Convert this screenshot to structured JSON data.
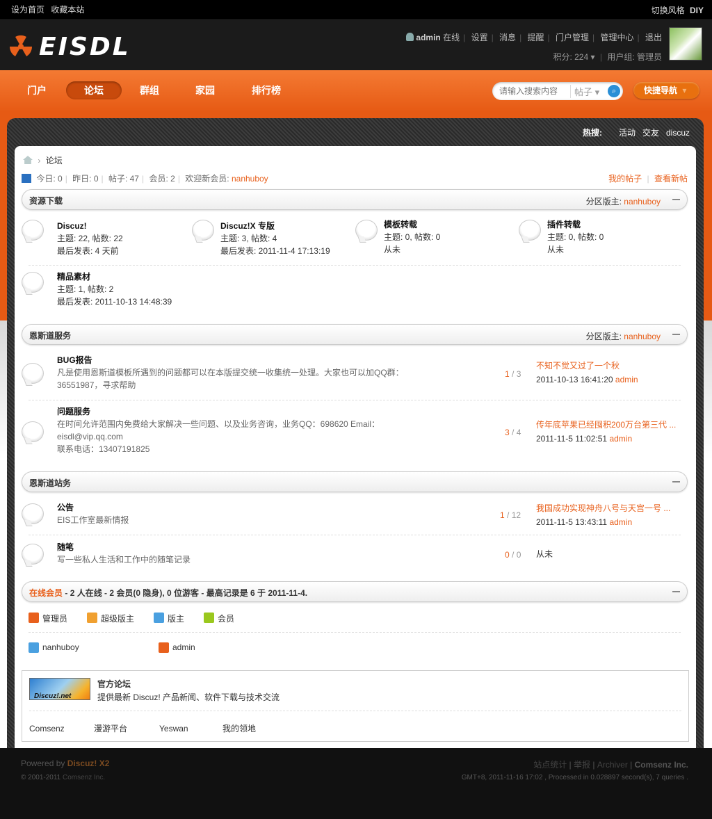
{
  "topbar": {
    "left": [
      "设为首页",
      "收藏本站"
    ],
    "switch": "切换风格",
    "diy": "DIY"
  },
  "header": {
    "logo": "EISDL",
    "user": "admin",
    "online": "在线",
    "menu": [
      "设置",
      "消息",
      "提醒",
      "门户管理",
      "管理中心",
      "退出"
    ],
    "points": "积分: 224",
    "group": "用户组: 管理员"
  },
  "nav": {
    "items": [
      "门户",
      "论坛",
      "群组",
      "家园",
      "排行榜"
    ],
    "active": 1,
    "search_placeholder": "请输入搜索内容",
    "search_type": "帖子",
    "quick_nav": "快捷导航"
  },
  "hot": {
    "label": "热搜:",
    "items": [
      "活动",
      "交友",
      "discuz"
    ]
  },
  "breadcrumb": {
    "current": "论坛"
  },
  "stats": {
    "today": "今日: 0",
    "yesterday": "昨日: 0",
    "posts": "帖子: 47",
    "members": "会员: 2",
    "welcome": "欢迎新会员:",
    "newuser": "nanhuboy",
    "mythreads": "我的帖子",
    "newposts": "查看新帖"
  },
  "sections": [
    {
      "title": "资源下载",
      "mod_label": "分区版主:",
      "mod": "nanhuboy",
      "forums": [
        {
          "name": "Discuz!",
          "stats": "主题: 22, 帖数: 22",
          "last": "最后发表: 4 天前"
        },
        {
          "name": "Discuz!X 专版",
          "stats": "主题: 3, 帖数: 4",
          "last": "最后发表: 2011-11-4 17:13:19"
        },
        {
          "name": "模板转载",
          "stats": "主题: 0, 帖数: 0",
          "last": "从未"
        },
        {
          "name": "插件转载",
          "stats": "主题: 0, 帖数: 0",
          "last": "从未"
        },
        {
          "name": "精品素材",
          "stats": "主题: 1, 帖数: 2",
          "last": "最后发表: 2011-10-13 14:48:39"
        }
      ]
    },
    {
      "title": "恩斯道服务",
      "mod_label": "分区版主:",
      "mod": "nanhuboy",
      "forums": [
        {
          "name": "BUG报告",
          "desc1": "凡是使用恩斯道模板所遇到的问题都可以在本版提交统一收集统一处理。大家也可以加QQ群：",
          "desc2": "36551987，寻求帮助",
          "threads": "1",
          "posts": "3",
          "last_title": "不知不觉又过了一个秋",
          "last_time": "2011-10-13 16:41:20",
          "last_user": "admin"
        },
        {
          "name": "问题服务",
          "desc1": "在时间允许范围内免费给大家解决一些问题、以及业务咨询，业务QQ：698620 Email：",
          "desc2": "eisdl@vip.qq.com",
          "desc3": "联系电话：13407191825",
          "threads": "3",
          "posts": "4",
          "last_title": "传年底苹果已经囤积200万台第三代 ...",
          "last_time": "2011-11-5 11:02:51",
          "last_user": "admin"
        }
      ]
    },
    {
      "title": "恩斯道站务",
      "forums": [
        {
          "name": "公告",
          "desc1": "EIS工作室最新情报",
          "threads": "1",
          "posts": "12",
          "last_title": "我国成功实现神舟八号与天宫一号 ...",
          "last_time": "2011-11-5 13:43:11",
          "last_user": "admin"
        },
        {
          "name": "随笔",
          "desc1": "写一些私人生活和工作中的随笔记录",
          "threads": "0",
          "posts": "0",
          "last_none": "从未"
        }
      ]
    }
  ],
  "online": {
    "title": "在线会员",
    "summary": "- 2 人在线 - 2 会员(0 隐身), 0 位游客 - 最高记录是 6 于 2011-11-4.",
    "legend": [
      {
        "label": "管理员",
        "color": "#e8601c"
      },
      {
        "label": "超级版主",
        "color": "#f0a030"
      },
      {
        "label": "版主",
        "color": "#4aa0e0"
      },
      {
        "label": "会员",
        "color": "#9ac81e"
      }
    ],
    "users": [
      {
        "name": "nanhuboy",
        "color": "#4aa0e0"
      },
      {
        "name": "admin",
        "color": "#e8601c"
      }
    ]
  },
  "links": {
    "logo_text": "Discuz!.net",
    "title": "官方论坛",
    "desc": "提供最新 Discuz! 产品新闻、软件下载与技术交流",
    "items": [
      "Comsenz",
      "漫游平台",
      "Yeswan",
      "我的领地"
    ]
  },
  "footer": {
    "powered": "Powered by",
    "product": "Discuz! X2",
    "copyright": "© 2001-2011",
    "company": "Comsenz Inc.",
    "links": [
      "站点统计",
      "举报",
      "Archiver",
      "Comsenz Inc."
    ],
    "info": "GMT+8, 2011-11-16 17:02 , Processed in 0.028897 second(s), 7 queries ."
  }
}
